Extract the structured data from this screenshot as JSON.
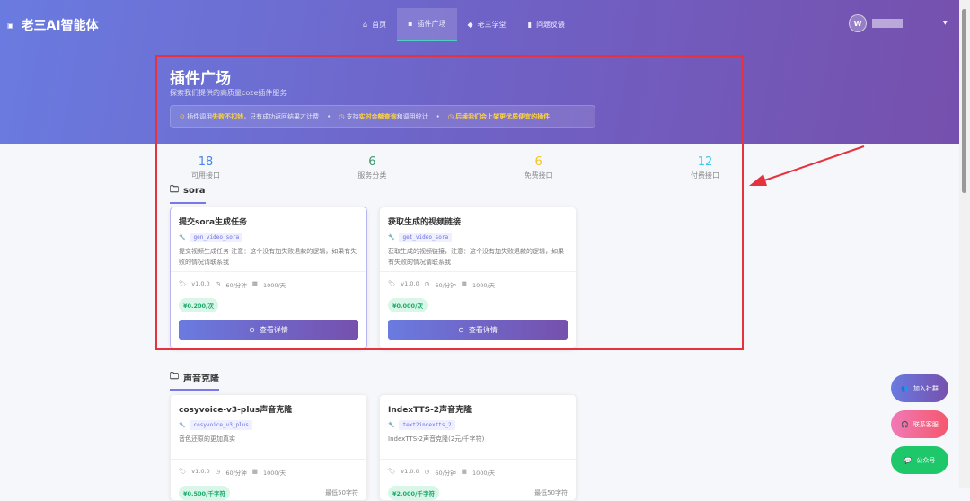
{
  "header": {
    "logo": "老三AI智能体",
    "nav": [
      {
        "icon": "home-icon",
        "label": "首页"
      },
      {
        "icon": "plugin-icon",
        "label": "插件广场"
      },
      {
        "icon": "school-icon",
        "label": "老三学堂"
      },
      {
        "icon": "feedback-icon",
        "label": "问题反馈"
      }
    ],
    "avatar": "W"
  },
  "hero": {
    "title": "插件广场",
    "subtitle": "探索我们提供的高质量coze插件服务",
    "notices": [
      {
        "pre": "插件调用",
        "hl": "失败不扣钱",
        "post": "，只有成功返回结果才计费"
      },
      {
        "pre": "支持",
        "hl": "实时余额查询",
        "post": "和调用统计"
      },
      {
        "pre": "",
        "hl": "后续我们会上架更优质便宜的插件",
        "post": ""
      }
    ]
  },
  "stats": [
    {
      "value": "18",
      "label": "可用接口",
      "color": "#4a86e8"
    },
    {
      "value": "6",
      "label": "服务分类",
      "color": "#3a9a6a"
    },
    {
      "value": "6",
      "label": "免费接口",
      "color": "#f5c518"
    },
    {
      "value": "12",
      "label": "付费接口",
      "color": "#3cc8e8"
    }
  ],
  "sections": [
    {
      "name": "sora",
      "cards": [
        {
          "title": "提交sora生成任务",
          "code": "gen_video_sora",
          "desc": "提交视频生成任务 注意：这个没有加失败退款的逻辑，如果有失败的情况请联系我",
          "version": "v1.0.0",
          "rate": "60/分钟",
          "daily": "1000/天",
          "price": "¥0.200/次",
          "min": "",
          "button": "查看详情"
        },
        {
          "title": "获取生成的视频链接",
          "code": "get_video_sora",
          "desc": "获取生成的视频链接，注意：这个没有加失败退款的逻辑，如果有失败的情况请联系我",
          "version": "v1.0.0",
          "rate": "60/分钟",
          "daily": "1000/天",
          "price": "¥0.000/次",
          "min": "",
          "button": "查看详情"
        }
      ]
    },
    {
      "name": "声音克隆",
      "cards": [
        {
          "title": "cosyvoice-v3-plus声音克隆",
          "code": "cosyvoice_v3_plus",
          "desc": "音色还原的更加真实",
          "version": "v1.0.0",
          "rate": "60/分钟",
          "daily": "1000/天",
          "price": "¥0.500/千字符",
          "min": "最低50字符"
        },
        {
          "title": "IndexTTS-2声音克隆",
          "code": "text2indextts_2",
          "desc": "IndexTTS-2声音克隆(2元/千字符)",
          "version": "v1.0.0",
          "rate": "60/分钟",
          "daily": "1000/天",
          "price": "¥2.000/千字符",
          "min": "最低50字符"
        }
      ]
    }
  ],
  "fabs": [
    {
      "label": "加入社群",
      "icon": "group-icon"
    },
    {
      "label": "联系客服",
      "icon": "headset-icon"
    },
    {
      "label": "公众号",
      "icon": "wechat-icon"
    }
  ]
}
